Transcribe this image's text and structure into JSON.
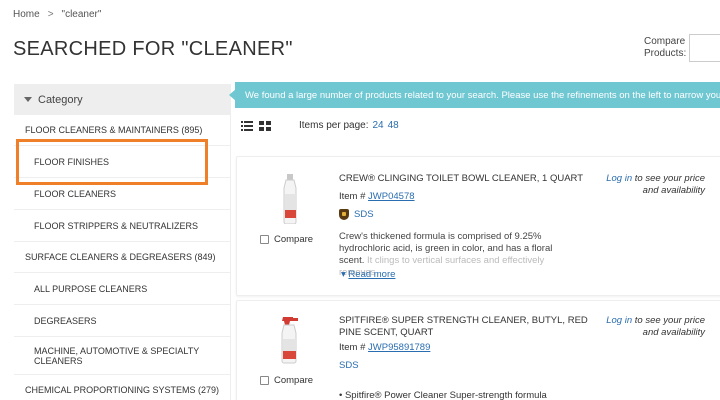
{
  "breadcrumb": {
    "home": "Home",
    "separator": ">",
    "current": "\"cleaner\""
  },
  "page_title": "SEARCHED FOR \"CLEANER\"",
  "compare_products": {
    "label_line1": "Compare",
    "label_line2": "Products:"
  },
  "sidebar": {
    "header": "Category",
    "items": [
      {
        "label": "FLOOR CLEANERS & MAINTAINERS (895)"
      },
      {
        "label": "FLOOR FINISHES"
      },
      {
        "label": "FLOOR CLEANERS"
      },
      {
        "label": "FLOOR STRIPPERS & NEUTRALIZERS"
      },
      {
        "label": "SURFACE CLEANERS & DEGREASERS (849)"
      },
      {
        "label": "ALL PURPOSE CLEANERS"
      },
      {
        "label": "DEGREASERS"
      },
      {
        "label": "MACHINE, AUTOMOTIVE & SPECIALTY CLEANERS"
      },
      {
        "label": "CHEMICAL PROPORTIONING SYSTEMS (279)"
      }
    ]
  },
  "banner": "We found a large number of products related to your search. Please use the refinements on the left to narrow your results.",
  "toolbar": {
    "items_per_page_label": "Items per page:",
    "option_24": "24",
    "option_48": "48"
  },
  "products": [
    {
      "title": "CREW® CLINGING TOILET BOWL CLEANER, 1 QUART",
      "item_label": "Item #",
      "item_number": "JWP04578",
      "sds": "SDS",
      "description": "Crew's thickened formula is comprised of 9.25% hydrochloric acid, is green in color, and has a floral scent.",
      "description_fade": "It clings to vertical surfaces and effectively removes",
      "read_more": "Read more",
      "compare": "Compare",
      "price_login": "Log in",
      "price_rest": "to see your price and availability"
    },
    {
      "title_line1": "SPITFIRE® SUPER STRENGTH CLEANER, BUTYL, RED",
      "title_line2": "PINE SCENT, QUART",
      "item_label": "Item #",
      "item_number": "JWP95891789",
      "sds": "SDS",
      "bullet": "•  Spitfire® Power Cleaner Super-strength formula",
      "compare": "Compare",
      "price_login": "Log in",
      "price_rest": "to see your price and availability"
    }
  ],
  "colors": {
    "banner": "#6fc7d2",
    "link": "#2a6db0",
    "highlight": "#f07f2a"
  }
}
